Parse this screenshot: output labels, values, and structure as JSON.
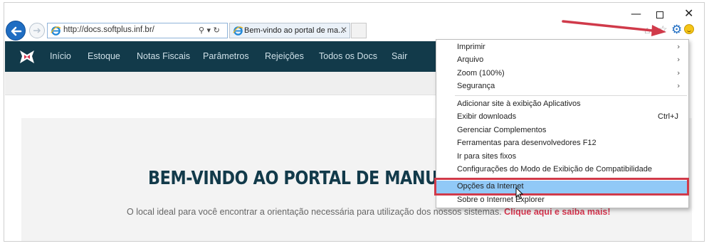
{
  "browser": {
    "url": "http://docs.softplus.inf.br/",
    "tab_title": "Bem-vindo ao portal de ma...",
    "tab_close": "✕",
    "addr_icons": "⚲ ▾ ↻",
    "window_controls": {
      "minimize": "—",
      "restore": "□",
      "close": "✕"
    }
  },
  "site": {
    "nav": [
      "Início",
      "Estoque",
      "Notas Fiscais",
      "Parâmetros",
      "Rejeições",
      "Todos os Docs",
      "Sair"
    ],
    "hero_title": "BEM-VINDO AO PORTAL DE MANUAI",
    "hero_subtitle": "O local ideal para você encontrar a orientação necessária para utilização dos nossos sistemas.",
    "hero_cta": "Clique aqui e saiba mais!"
  },
  "menu": {
    "items": [
      {
        "label": "Imprimir",
        "submenu": true
      },
      {
        "label": "Arquivo",
        "submenu": true
      },
      {
        "label": "Zoom (100%)",
        "submenu": true
      },
      {
        "label": "Segurança",
        "submenu": true
      },
      {
        "label": "Adicionar site à exibição Aplicativos"
      },
      {
        "label": "Exibir downloads",
        "shortcut": "Ctrl+J"
      },
      {
        "label": "Gerenciar Complementos"
      },
      {
        "label": "Ferramentas para desenvolvedores F12"
      },
      {
        "label": "Ir para sites fixos"
      },
      {
        "label": "Configurações do Modo de Exibição de Compatibilidade"
      },
      {
        "label": "Opções da Internet",
        "highlighted": true
      },
      {
        "label": "Sobre o Internet Explorer"
      }
    ],
    "chevron": "›"
  },
  "icons": {
    "gear": "⚙",
    "home": "⌂",
    "star": "☆"
  },
  "colors": {
    "nav_bg": "#123a4a",
    "title": "#123a4a",
    "cta": "#d7354f",
    "highlight": "#91c9f7",
    "annotation": "#d03a4a",
    "ie_blue": "#1f6dc2"
  }
}
